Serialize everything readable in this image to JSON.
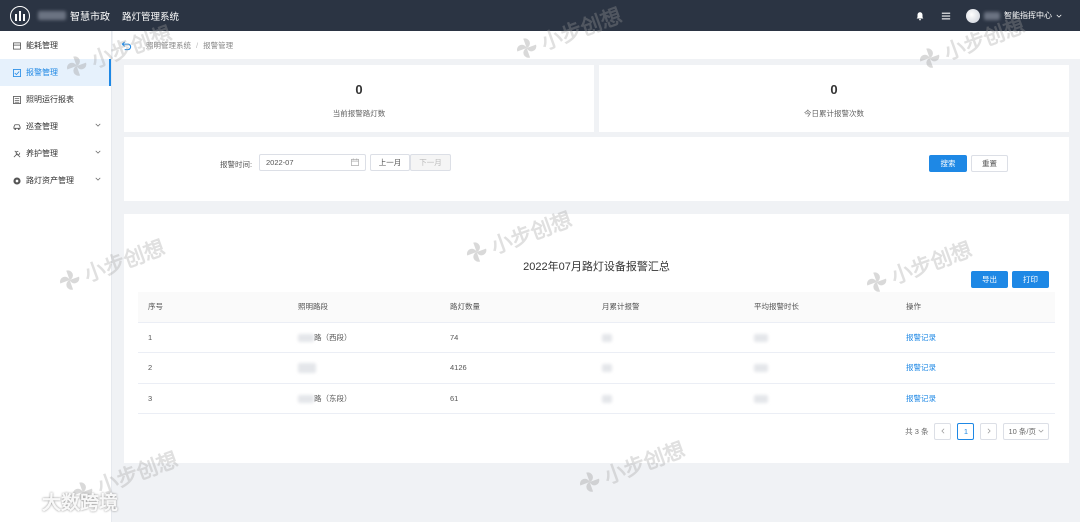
{
  "header": {
    "city": "智慧市政",
    "system": "路灯管理系统",
    "user": "智能指挥中心"
  },
  "sidebar": {
    "items": [
      {
        "label": "能耗管理",
        "icon": "box-icon"
      },
      {
        "label": "报警管理",
        "icon": "alarm-icon"
      },
      {
        "label": "照明运行报表",
        "icon": "report-icon"
      },
      {
        "label": "巡查管理",
        "icon": "car-icon"
      },
      {
        "label": "养护管理",
        "icon": "tools-icon"
      },
      {
        "label": "路灯资产管理",
        "icon": "asset-icon"
      }
    ]
  },
  "breadcrumb": {
    "root": "照明管理系统",
    "separator": "/",
    "current": "报警管理"
  },
  "stats": [
    {
      "value": "0",
      "label": "当前报警路灯数"
    },
    {
      "value": "0",
      "label": "今日累计报警次数"
    }
  ],
  "search": {
    "label": "报警时间:",
    "date_value": "2022-07",
    "prev_month": "上一月",
    "next_month": "下一月",
    "search_btn": "搜索",
    "reset_btn": "重置"
  },
  "summary": {
    "title": "2022年07月路灯设备报警汇总",
    "export_btn": "导出",
    "print_btn": "打印",
    "columns": [
      "序号",
      "照明路段",
      "路灯数量",
      "月累计报警",
      "平均报警时长",
      "操作"
    ],
    "rows": [
      {
        "index": "1",
        "road": "路（西段）",
        "count": "74",
        "action": "报警记录"
      },
      {
        "index": "2",
        "road": "",
        "count": "4126",
        "action": "报警记录"
      },
      {
        "index": "3",
        "road": "路（东段）",
        "count": "61",
        "action": "报警记录"
      }
    ]
  },
  "pagination": {
    "total": "共 3 条",
    "current_page": "1",
    "page_size": "10 条/页"
  },
  "watermark": {
    "text": "小步创想",
    "corner": "大数跨境"
  },
  "colors": {
    "topbar": "#2b3443",
    "primary": "#1e88e5",
    "background": "#f0f2f5"
  }
}
